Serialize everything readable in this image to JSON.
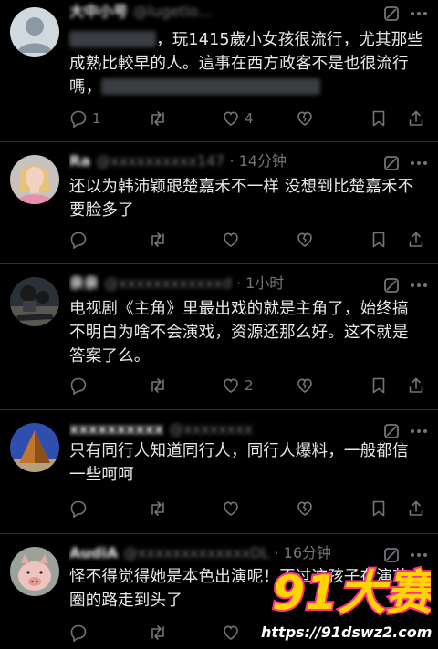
{
  "posts": [
    {
      "time": "",
      "text": [
        "，玩1415歲小女孩很流行，尤其那些",
        "成熟比較早的人。這事在西方政客不是也很流行",
        "嗎，"
      ],
      "counts": {
        "reply": "1",
        "repost": "",
        "like": "4",
        "views": ""
      },
      "avatar": "default-avatar"
    },
    {
      "time": "· 14分钟",
      "text": [
        "还以为韩沛颖跟楚嘉禾不一样 没想到比楚嘉禾不",
        "要脸多了"
      ],
      "counts": {
        "reply": "",
        "repost": "",
        "like": "",
        "views": ""
      },
      "avatar": "woman-avatar"
    },
    {
      "time": "· 1小时",
      "text": [
        "电视剧《主角》里最出戏的就是主角了，始终搞",
        "不明白为啥不会演戏，资源还那么好。这不就是",
        "答案了么。"
      ],
      "counts": {
        "reply": "",
        "repost": "",
        "like": "2",
        "views": ""
      },
      "avatar": "rider-avatar"
    },
    {
      "time": "",
      "text": [
        "只有同行人知道同行人，同行人爆料，一般都信",
        "一些呵呵"
      ],
      "counts": {
        "reply": "",
        "repost": "",
        "like": "",
        "views": ""
      },
      "avatar": "pyramid-avatar"
    },
    {
      "time": "· 16分钟",
      "text": [
        "怪不得觉得她是本色出演呢！不过这孩子在演艺",
        "圈的路走到头了"
      ],
      "counts": {
        "reply": "",
        "repost": "",
        "like": "",
        "views": ""
      },
      "avatar": "pig-avatar"
    }
  ],
  "watermark": {
    "logo_text": "91大赛",
    "url": "https://91dswz2.com"
  },
  "colors": {
    "background": "#000000",
    "text": "#e7e9ea",
    "muted": "#71767b",
    "divider": "#2f3336",
    "watermark_primary": "#ff2e88",
    "watermark_secondary": "#ffd400"
  }
}
